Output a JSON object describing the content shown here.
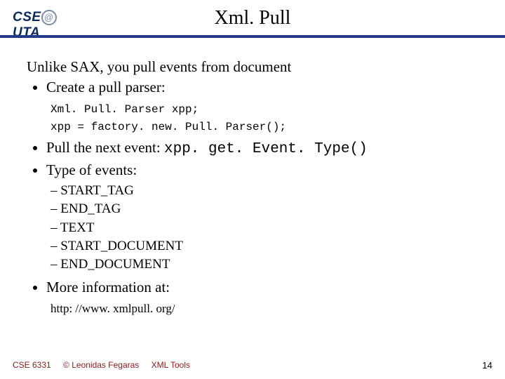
{
  "header": {
    "logo": {
      "left": "CSE",
      "at": "@",
      "right": "UTA"
    },
    "title": "Xml. Pull"
  },
  "intro": "Unlike SAX, you pull events from document",
  "bullets": {
    "create": "Create a pull parser:",
    "code1": "Xml. Pull. Parser xpp;",
    "code2": "xpp = factory. new. Pull. Parser();",
    "pull_prefix": "Pull the next event:   ",
    "pull_code": "xpp. get. Event. Type()",
    "type_of_events": "Type of events:",
    "events": [
      "START_TAG",
      "END_TAG",
      "TEXT",
      "START_DOCUMENT",
      "END_DOCUMENT"
    ],
    "more_info": "More information at:",
    "url": "http: //www. xmlpull. org/"
  },
  "footer": {
    "course": "CSE 6331",
    "copyright": "© Leonidas Fegaras",
    "topic": "XML Tools",
    "page": "14"
  }
}
